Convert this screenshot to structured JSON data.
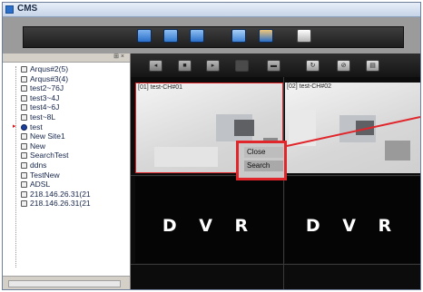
{
  "window": {
    "title": "CMS"
  },
  "toolbar": {
    "icons": [
      "monitor-icon",
      "camera-icon",
      "screen-icon",
      "network-icon",
      "user-icon",
      "power-icon"
    ]
  },
  "sidebar": {
    "dock_label": "⊞ ×",
    "items": [
      {
        "label": "Arqus#2(5)",
        "active": false
      },
      {
        "label": "Arqus#3(4)",
        "active": false
      },
      {
        "label": "test2~76J",
        "active": false
      },
      {
        "label": "test3~4J",
        "active": false
      },
      {
        "label": "test4~6J",
        "active": false
      },
      {
        "label": "test~8L",
        "active": false
      },
      {
        "label": "test",
        "active": true
      },
      {
        "label": "New Site1",
        "active": false
      },
      {
        "label": "New",
        "active": false
      },
      {
        "label": "SearchTest",
        "active": false
      },
      {
        "label": "ddns",
        "active": false
      },
      {
        "label": "TestNew",
        "active": false
      },
      {
        "label": "ADSL",
        "active": false
      },
      {
        "label": "218.146.26.31(21",
        "active": false
      },
      {
        "label": "218.146.26.31(21",
        "active": false
      }
    ]
  },
  "controls": {
    "buttons": [
      "prev-icon",
      "stop-icon",
      "play-icon",
      "layout-icon",
      "fullscreen-icon",
      "refresh-icon",
      "record-icon",
      "settings-icon"
    ]
  },
  "video": {
    "tiles": [
      {
        "label": "[01] test-CH#01",
        "type": "camera"
      },
      {
        "label": "[02] test-CH#02",
        "type": "camera"
      },
      {
        "label": "D V R",
        "type": "dvr"
      },
      {
        "label": "D V R",
        "type": "dvr"
      }
    ]
  },
  "context_menu": {
    "items": [
      "Close",
      "Search"
    ]
  },
  "colors": {
    "highlight": "#e0262b",
    "toolbar_icon": "#2a74d4"
  }
}
